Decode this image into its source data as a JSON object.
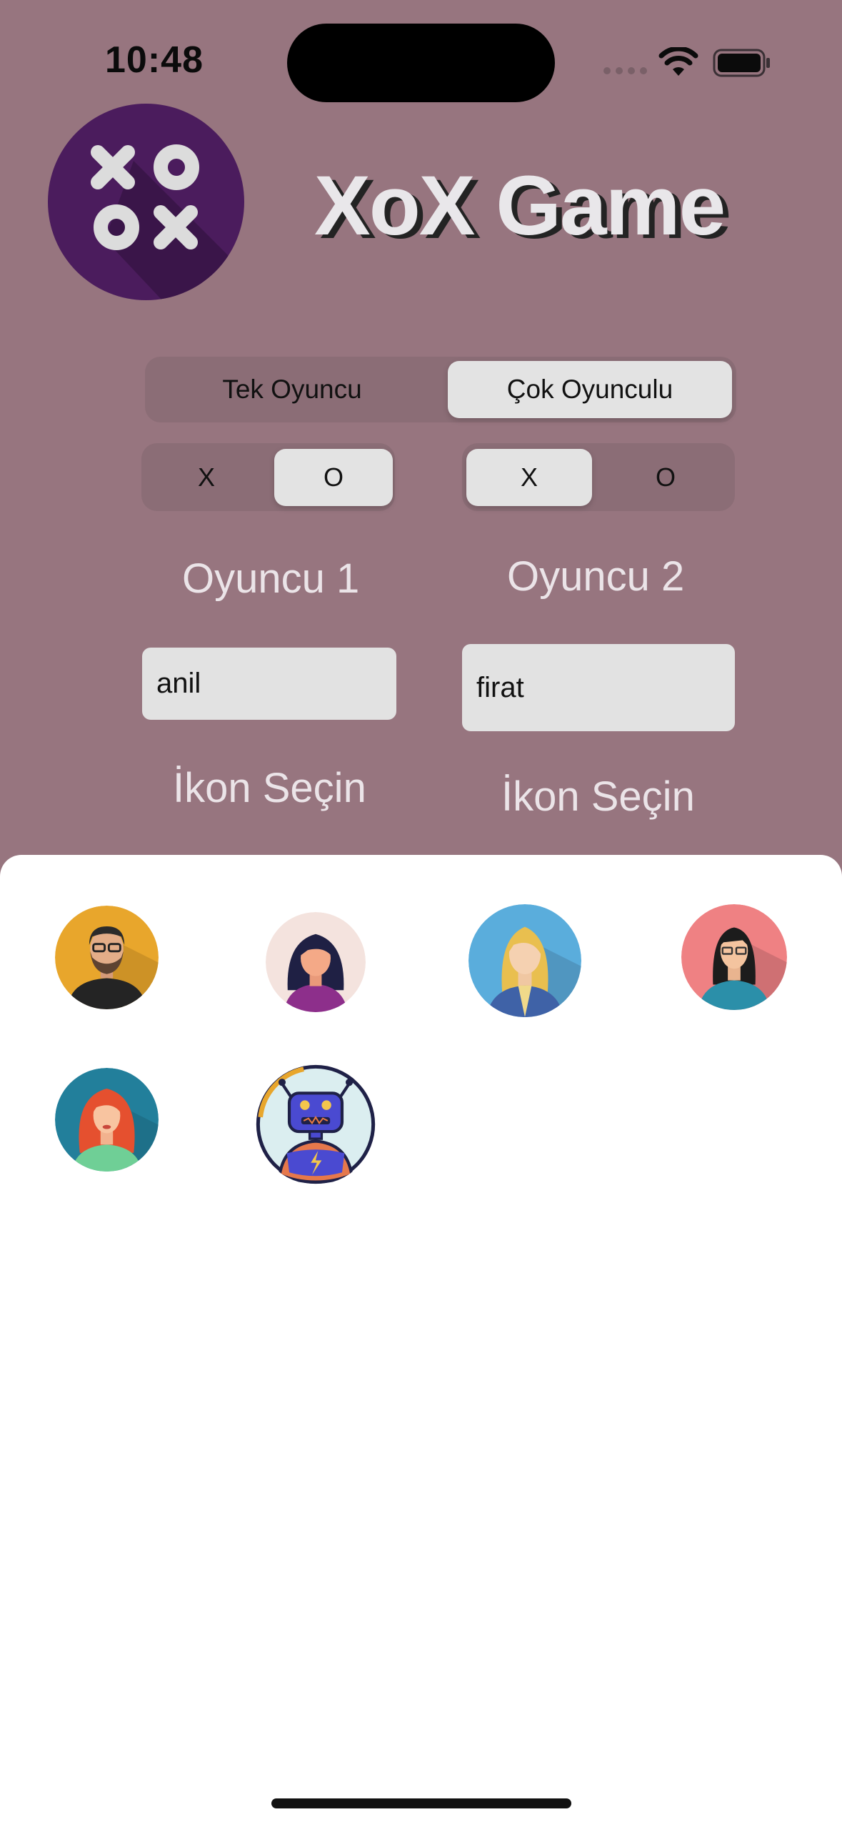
{
  "status_bar": {
    "time": "10:48"
  },
  "app": {
    "title": "XoX Game"
  },
  "mode_selector": {
    "options": [
      "Tek Oyuncu",
      "Çok Oyunculu"
    ],
    "selected": "Çok Oyunculu"
  },
  "player1": {
    "symbol_options": [
      "X",
      "O"
    ],
    "selected_symbol": "O",
    "label": "Oyuncu 1",
    "name_value": "anil",
    "icon_label": "İkon Seçin"
  },
  "player2": {
    "symbol_options": [
      "X",
      "O"
    ],
    "selected_symbol": "X",
    "label": "Oyuncu 2",
    "name_value": "firat",
    "icon_label": "İkon Seçin"
  },
  "icon_picker": {
    "icons": [
      "man-beard-glasses-avatar",
      "woman-dark-hair-avatar",
      "woman-blonde-avatar",
      "woman-glasses-avatar",
      "woman-red-hair-avatar",
      "robot-avatar"
    ]
  },
  "colors": {
    "background": "#97757f",
    "sheet": "#ffffff",
    "logo": "#4b1c5d"
  }
}
